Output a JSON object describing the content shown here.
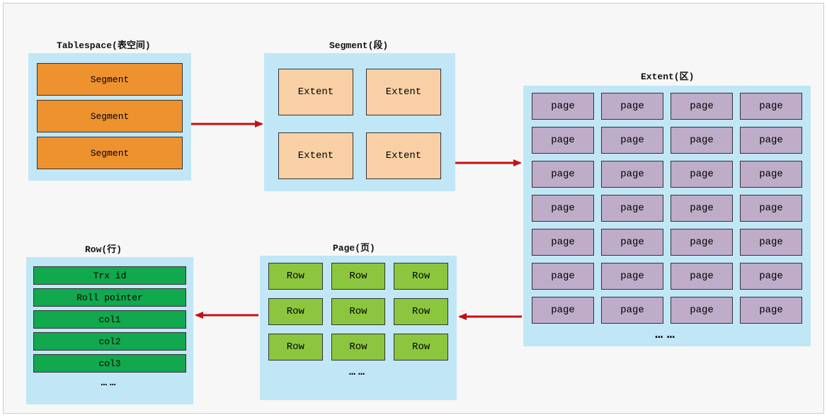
{
  "tablespace": {
    "title": "Tablespace(表空间)",
    "segments": [
      "Segment",
      "Segment",
      "Segment"
    ]
  },
  "segment": {
    "title": "Segment(段)",
    "extents": [
      "Extent",
      "Extent",
      "Extent",
      "Extent"
    ]
  },
  "extent": {
    "title": "Extent(区)",
    "page_label": "page",
    "rows": 7,
    "cols": 4,
    "ellipsis": "……"
  },
  "page": {
    "title": "Page(页)",
    "row_label": "Row",
    "rows": 3,
    "cols": 3,
    "ellipsis": "……"
  },
  "row": {
    "title": "Row(行)",
    "fields": [
      "Trx id",
      "Roll pointer",
      "col1",
      "col2",
      "col3"
    ],
    "ellipsis": "……"
  },
  "arrow_color": "#c41111"
}
